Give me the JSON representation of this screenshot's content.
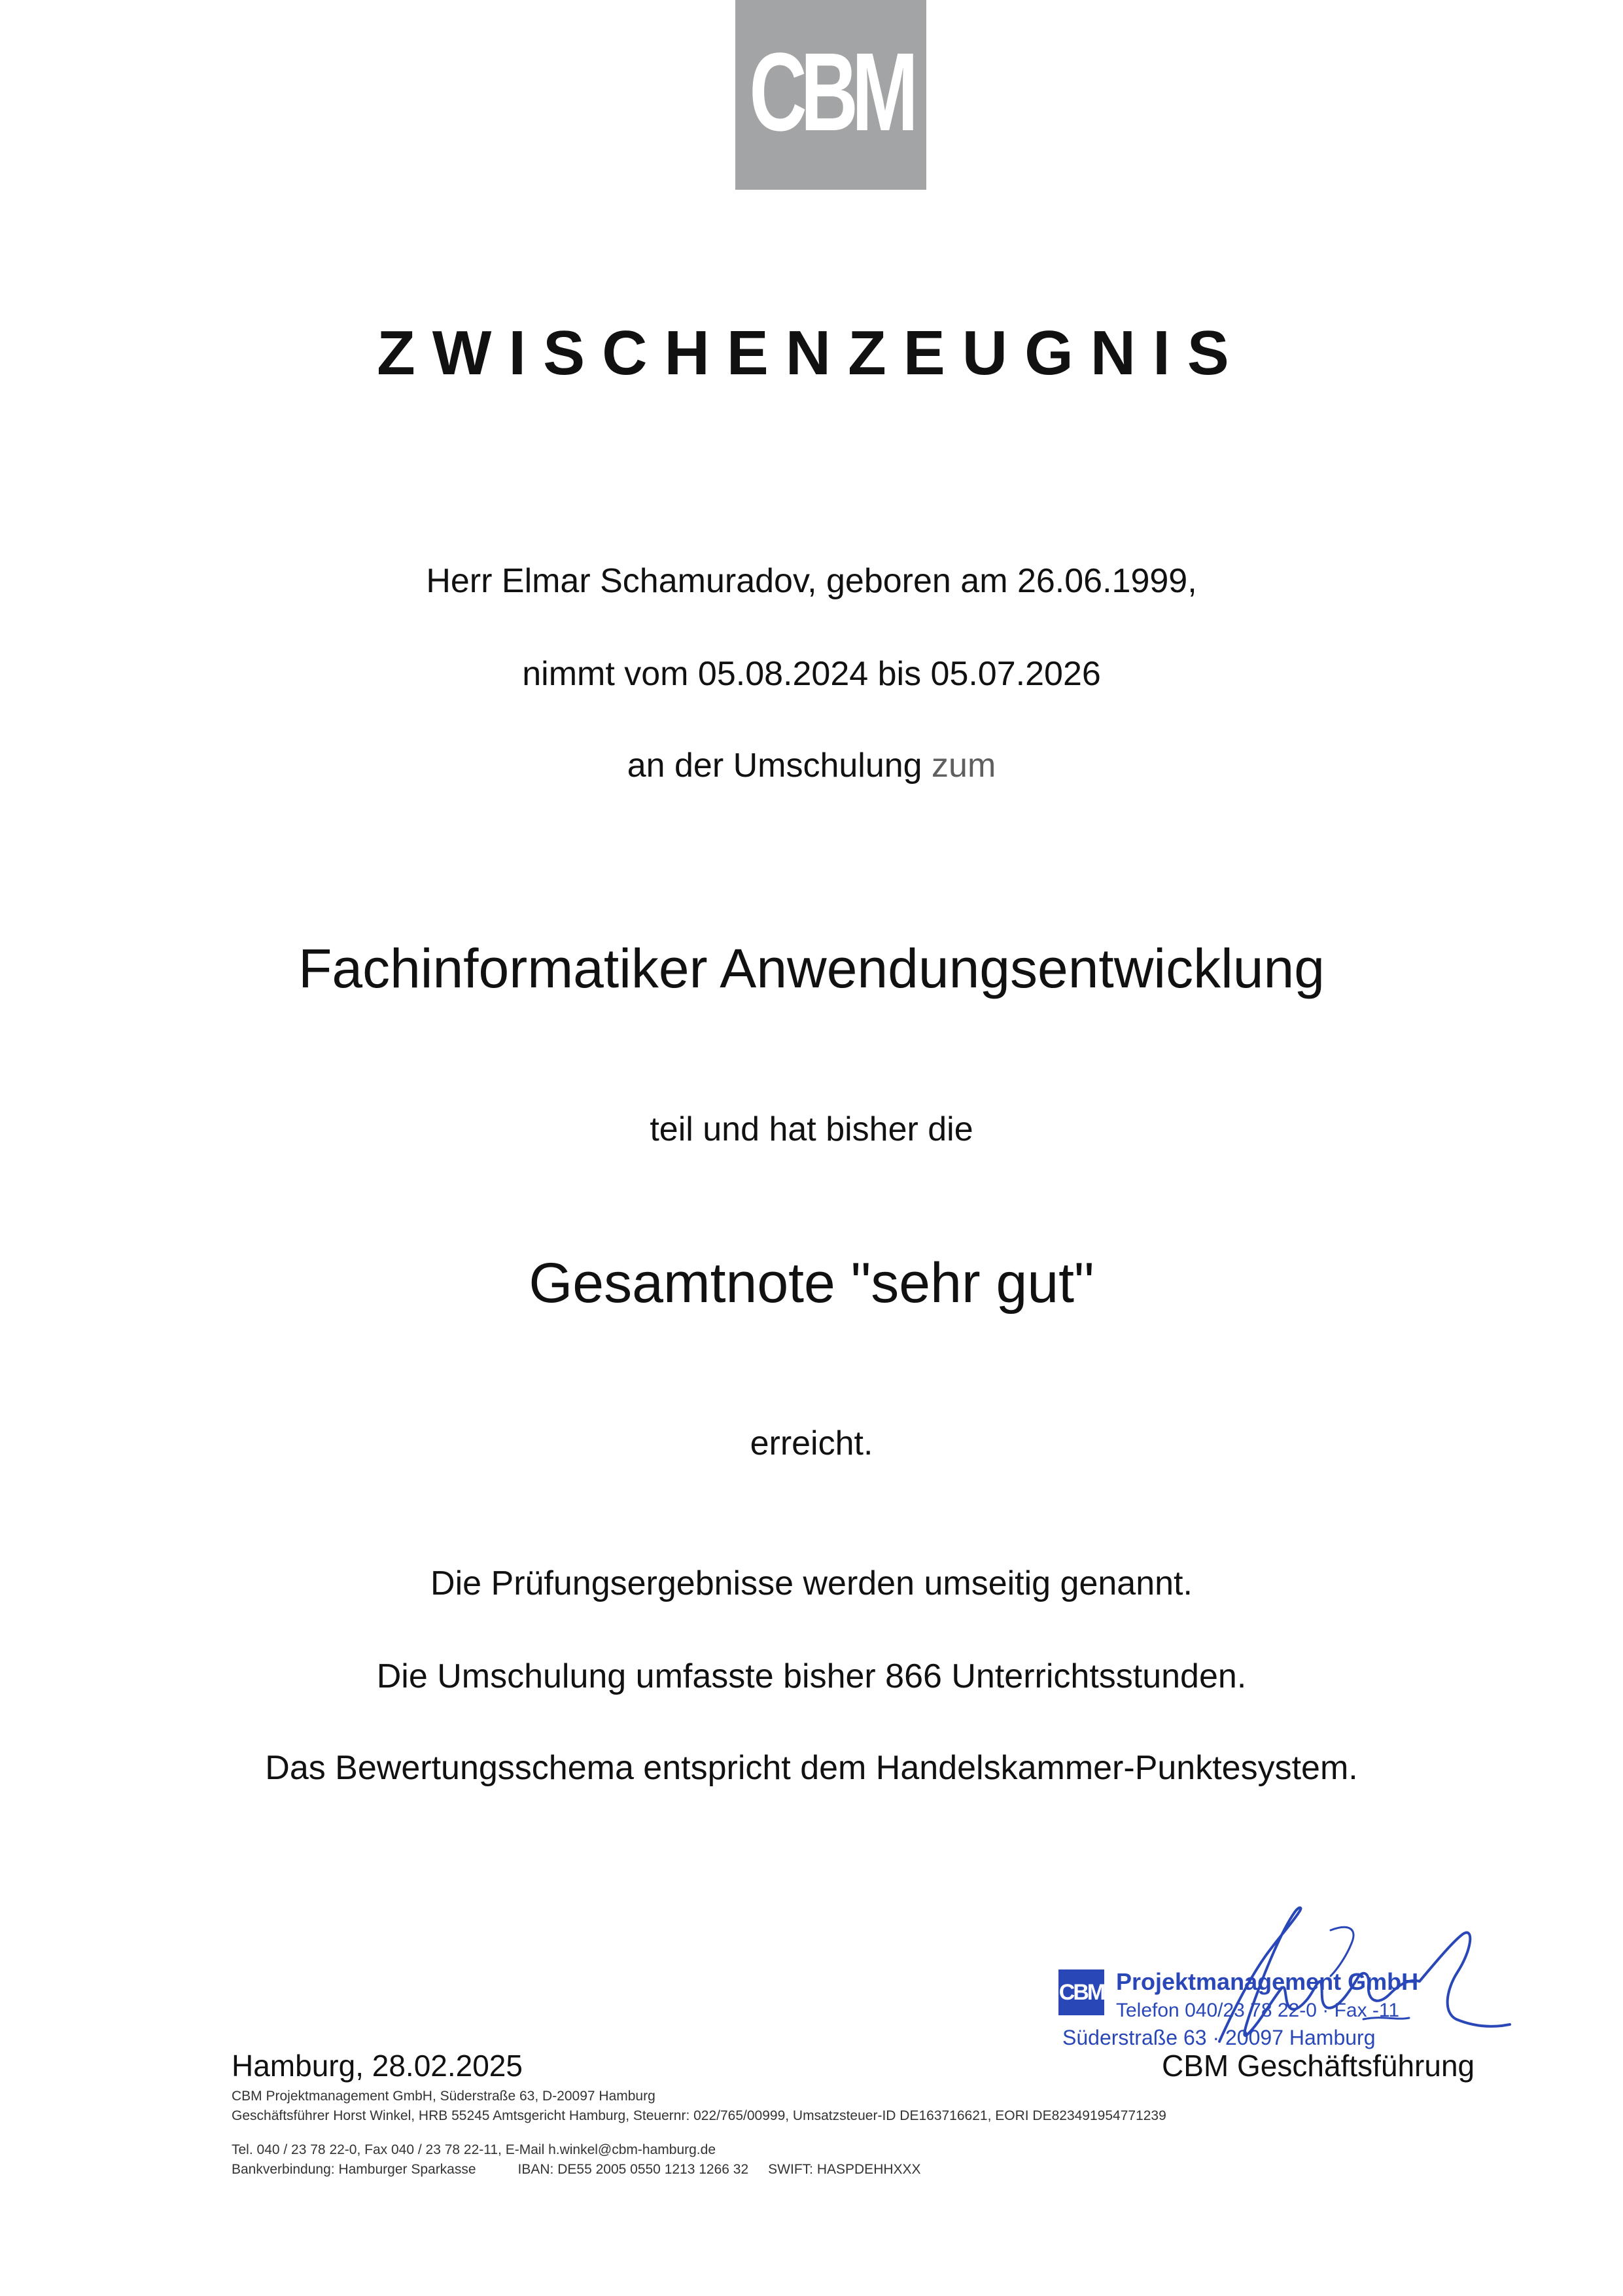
{
  "logo": {
    "text": "CBM",
    "color": "#a3a4a6"
  },
  "title": "ZWISCHENZEUGNIS",
  "body": {
    "line1": "Herr Elmar Schamuradov, geboren am 26.06.1999,",
    "line2": "nimmt vom 05.08.2024 bis 05.07.2026",
    "line3_main": "an der Umschulung ",
    "line3_muted": "zum",
    "profession": "Fachinformatiker Anwendungsentwicklung",
    "line4": "teil und hat bisher die",
    "grade": "Gesamtnote \"sehr gut\"",
    "line5": "erreicht.",
    "line6": "Die Prüfungsergebnisse werden umseitig genannt.",
    "line7": "Die Umschulung umfasste bisher 866 Unterrichtsstunden.",
    "line8": "Das Bewertungsschema entspricht dem Handelskammer-Punktesystem."
  },
  "stamp": {
    "logo_text": "CBM",
    "company": "Projektmanagement GmbH",
    "phone": "Telefon 040/23 78 22-0 · Fax -11",
    "address": "Süderstraße 63 · 20097 Hamburg",
    "color": "#2a47b8"
  },
  "signature_block": {
    "place_date": "Hamburg, 28.02.2025",
    "signer": "CBM Geschäftsführung"
  },
  "footer": {
    "line1": "CBM Projektmanagement GmbH, Süderstraße 63, D-20097 Hamburg",
    "line2": "Geschäftsführer Horst Winkel, HRB 55245 Amtsgericht Hamburg, Steuernr: 022/765/00999, Umsatzsteuer-ID DE163716621, EORI DE823491954771239",
    "line3": "Tel. 040 / 23 78 22-0, Fax 040 / 23 78 22-11, E-Mail h.winkel@cbm-hamburg.de",
    "bank_label": "Bankverbindung: Hamburger Sparkasse",
    "iban": "IBAN:  DE55 2005 0550 1213 1266 32",
    "swift": "SWIFT:  HASPDEHHXXX"
  }
}
